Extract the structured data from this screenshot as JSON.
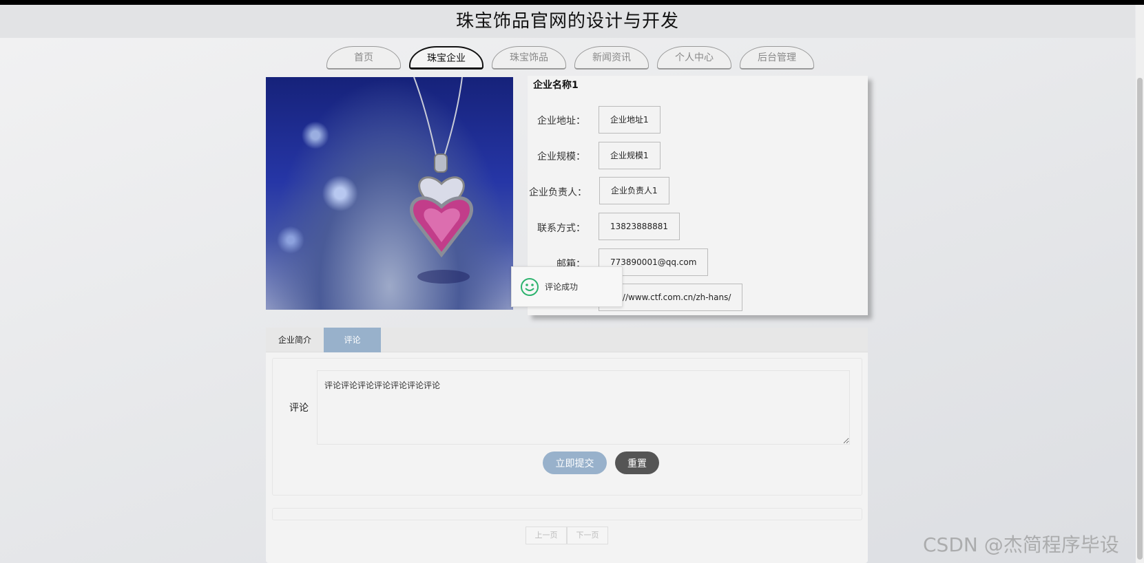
{
  "header": {
    "title": "珠宝饰品官网的设计与开发"
  },
  "nav": {
    "tabs": [
      {
        "label": "首页",
        "active": false
      },
      {
        "label": "珠宝企业",
        "active": true
      },
      {
        "label": "珠宝饰品",
        "active": false
      },
      {
        "label": "新闻资讯",
        "active": false
      },
      {
        "label": "个人中心",
        "active": false
      },
      {
        "label": "后台管理",
        "active": false
      }
    ]
  },
  "company": {
    "name": "企业名称1",
    "fields": [
      {
        "label": "企业地址：",
        "value": "企业地址1"
      },
      {
        "label": "企业规模：",
        "value": "企业规模1"
      },
      {
        "label": "企业负责人：",
        "value": "企业负责人1"
      },
      {
        "label": "联系方式：",
        "value": "13823888881"
      },
      {
        "label": "邮箱：",
        "value": "773890001@qq.com"
      },
      {
        "label": "",
        "value": "ps://www.ctf.com.cn/zh-hans/"
      }
    ]
  },
  "toast": {
    "message": "评论成功",
    "icon": "smiley-icon",
    "color": "#2db36e"
  },
  "tabs": {
    "intro": "企业简介",
    "comment": "评论"
  },
  "comment_form": {
    "label": "评论",
    "value": "评论评论评论评论评论评论评论",
    "submit": "立即提交",
    "reset": "重置"
  },
  "pager": {
    "prev": "上一页",
    "next": "下一页"
  },
  "watermark": "CSDN @杰简程序毕设",
  "colors": {
    "accent": "#98b1cb",
    "reset_button": "#555555"
  }
}
